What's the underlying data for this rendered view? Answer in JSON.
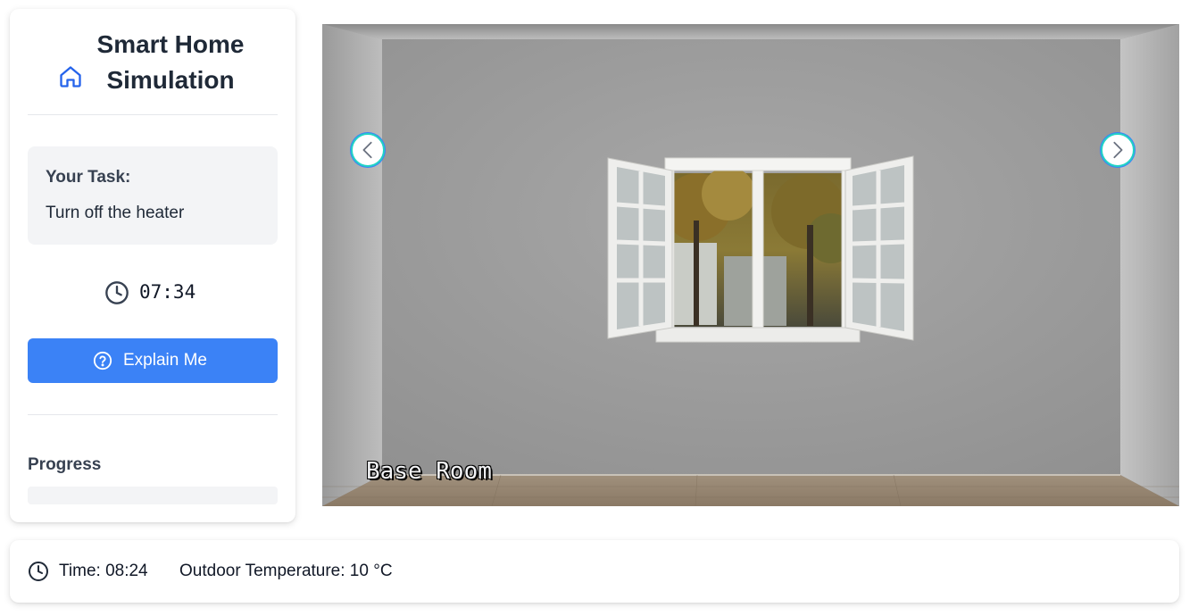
{
  "sidebar": {
    "title_line1": "Smart Home",
    "title_line2": "Simulation",
    "brand_icon": "home-icon",
    "task": {
      "heading": "Your Task:",
      "text": "Turn off the heater"
    },
    "timer": {
      "icon": "clock-icon",
      "value": "07:34"
    },
    "explain_button": {
      "icon": "help-circle-icon",
      "label": "Explain Me"
    },
    "progress": {
      "title": "Progress",
      "value": 0
    }
  },
  "viewer": {
    "room_label": "Base Room",
    "prev_icon": "chevron-left-icon",
    "next_icon": "chevron-right-icon"
  },
  "status_bar": {
    "icon": "clock-icon",
    "time_text": "Time: 08:24",
    "temperature_text": "Outdoor Temperature: 10 °C"
  },
  "colors": {
    "accent": "#3b82f6",
    "nav_ring": "#22d3c5",
    "panel_bg": "#f3f4f6",
    "text": "#1f2937"
  }
}
